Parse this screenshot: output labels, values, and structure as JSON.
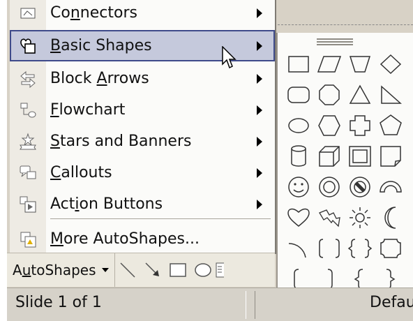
{
  "menu": {
    "items": [
      {
        "label": "Connectors",
        "icon": "connectors-icon",
        "submenu": true
      },
      {
        "label": "Basic Shapes",
        "icon": "basic-shapes-icon",
        "submenu": true,
        "highlighted": true
      },
      {
        "label": "Block Arrows",
        "icon": "block-arrows-icon",
        "submenu": true
      },
      {
        "label": "Flowchart",
        "icon": "flowchart-icon",
        "submenu": true
      },
      {
        "label": "Stars and Banners",
        "icon": "stars-banners-icon",
        "submenu": true
      },
      {
        "label": "Callouts",
        "icon": "callouts-icon",
        "submenu": true
      },
      {
        "label": "Action Buttons",
        "icon": "action-buttons-icon",
        "submenu": true
      },
      {
        "label": "More AutoShapes...",
        "icon": "more-autoshapes-icon",
        "submenu": false
      }
    ]
  },
  "submenu": {
    "title": "Basic Shapes",
    "shapes": [
      "rectangle",
      "parallelogram",
      "trapezoid",
      "diamond",
      "rounded-rectangle",
      "octagon",
      "triangle",
      "right-triangle",
      "oval",
      "hexagon",
      "cross",
      "pentagon",
      "can",
      "cube",
      "bevel",
      "folded-corner",
      "smiley-face",
      "donut",
      "no-symbol",
      "block-arc",
      "heart",
      "lightning-bolt",
      "sun",
      "moon",
      "arc",
      "double-bracket",
      "double-brace",
      "plaque",
      "left-bracket",
      "right-bracket",
      "left-brace",
      "right-brace"
    ]
  },
  "toolbar": {
    "autoshapes_label": "AutoShapes",
    "tools": [
      "line-icon",
      "arrow-icon",
      "rectangle-icon",
      "oval-icon",
      "textbox-icon"
    ]
  },
  "status": {
    "slide_text": "Slide 1 of 1",
    "design_text": "Defau"
  },
  "colors": {
    "highlight": "#c5c9dc",
    "highlight_border": "#3e4a8a",
    "gutter": "#eeebe4"
  }
}
